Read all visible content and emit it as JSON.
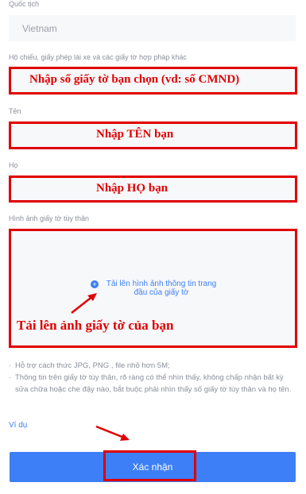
{
  "nationality": {
    "label": "Quốc tịch",
    "value": "Vietnam"
  },
  "document_number": {
    "label": "Hộ chiếu, giấy phép lái xe và các giấy tờ hợp pháp khác",
    "annotation": "Nhập số giấy tờ bạn chọn (vd: số CMND)"
  },
  "first_name": {
    "label": "Tên",
    "annotation": "Nhập TÊN bạn"
  },
  "last_name": {
    "label": "Họ",
    "annotation": "Nhập HỌ bạn"
  },
  "id_image": {
    "label": "Hình ảnh giấy tờ tùy thân",
    "upload_text": "Tải lên hình ảnh thông tin trang đầu của giấy tờ",
    "annotation": "Tải lên ảnh giấy tờ của bạn"
  },
  "notes": [
    "Hỗ trợ cách thức JPG, PNG , file nhỏ hơn 5M;",
    "Thông tin trên giấy tờ tùy thân, rõ ràng có thể nhìn thấy, không chấp nhận bất kỳ sửa chữa hoặc che đậy nào, bắt buộc phải nhìn thấy số giấy tờ tùy thân và họ tên."
  ],
  "example_link": "Ví dụ",
  "submit_label": "Xác nhận",
  "colors": {
    "accent": "#3d7ff6",
    "annotation_red": "#e00000",
    "field_bg": "#f7f8fa",
    "label_gray": "#8a8f99"
  }
}
